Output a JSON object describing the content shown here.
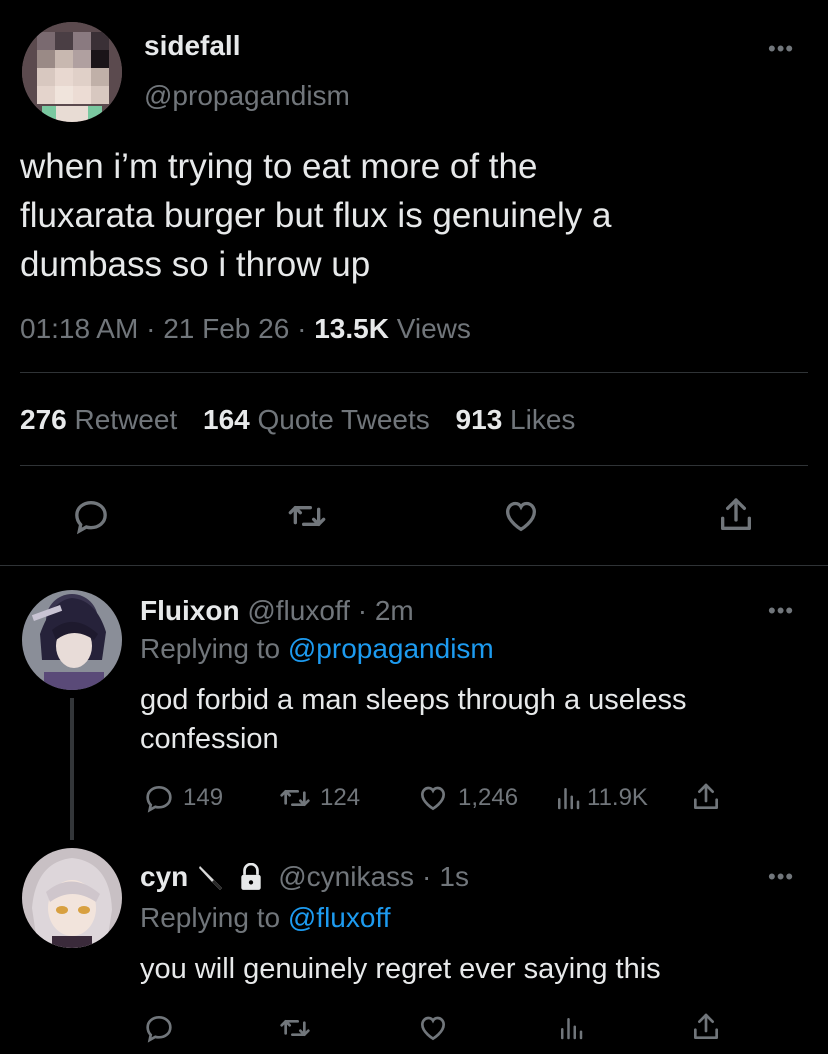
{
  "main_tweet": {
    "display_name": "sidefall",
    "handle": "@propagandism",
    "text_lines": [
      "when i’m trying to eat more of the",
      "fluxarata burger but flux is genuinely a",
      "dumbass so i throw up"
    ],
    "time": "01:18 AM",
    "date": "21 Feb 26",
    "views_count": "13.5K",
    "views_label": "Views",
    "retweets_count": "276",
    "retweets_label": "Retweet",
    "quotes_count": "164",
    "quotes_label": "Quote Tweets",
    "likes_count": "913",
    "likes_label": "Likes",
    "separator": "·"
  },
  "reply1": {
    "display_name": "Fluixon",
    "handle": "@fluxoff",
    "age": "2m",
    "replying_prefix": "Replying to",
    "replying_to": "@propagandism",
    "text_lines": [
      "god forbid a man sleeps through a useless",
      "confession"
    ],
    "reply_count": "149",
    "retweet_count": "124",
    "like_count": "1,246",
    "view_count": "11.9K"
  },
  "reply2": {
    "display_name": "cyn",
    "handle": "@cynikass",
    "age": "1s",
    "replying_prefix": "Replying to",
    "replying_to": "@fluxoff",
    "text_lines": [
      "you will genuinely regret ever saying this"
    ]
  },
  "colors": {
    "background": "#000000",
    "text": "#e7e9ea",
    "muted": "#71767b",
    "link": "#1d9bf0",
    "divider": "#2f3336"
  }
}
